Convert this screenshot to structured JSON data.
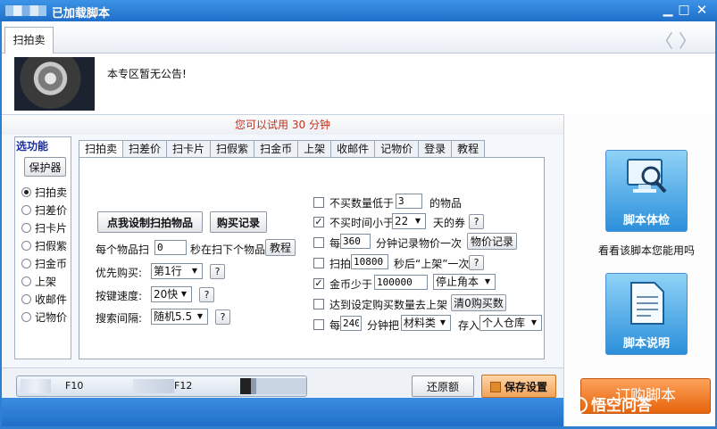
{
  "window": {
    "title": "已加载脚本",
    "minimize": "▁",
    "maximize": "□",
    "close": "✕"
  },
  "top_tab": {
    "label": "扫拍卖",
    "prev": "〈",
    "next": "〉"
  },
  "announcement": {
    "text": "本专区暂无公告!"
  },
  "trial": {
    "prefix": "您可以试用",
    "minutes": "30",
    "suffix": "分钟"
  },
  "functions": {
    "title": "选功能",
    "protector_label": "保护器",
    "items": [
      {
        "label": "扫拍卖",
        "selected": true
      },
      {
        "label": "扫差价",
        "selected": false
      },
      {
        "label": "扫卡片",
        "selected": false
      },
      {
        "label": "扫假紫",
        "selected": false
      },
      {
        "label": "扫金币",
        "selected": false
      },
      {
        "label": "上架",
        "selected": false
      },
      {
        "label": "收邮件",
        "selected": false
      },
      {
        "label": "记物价",
        "selected": false
      }
    ]
  },
  "tabs": [
    "扫拍卖",
    "扫差价",
    "扫卡片",
    "扫假紫",
    "扫金币",
    "上架",
    "收邮件",
    "记物价",
    "登录",
    "教程"
  ],
  "left_form": {
    "set_items_button": "点我设制扫拍物品",
    "purchase_record_button": "购买记录",
    "scan_prefix": "每个物品扫",
    "scan_value": "0",
    "scan_suffix": "秒在扫下个物品",
    "tutorial_button": "教程",
    "priority_label": "优先购买:",
    "priority_value": "第1行",
    "key_speed_label": "按键速度:",
    "key_speed_value": "20快",
    "interval_label": "搜索间隔:",
    "interval_value": "随机5.5",
    "help": "?"
  },
  "right_form": {
    "min_qty": {
      "checked": false,
      "prefix": "不买数量低于",
      "value": "3",
      "suffix": "的物品"
    },
    "time_limit": {
      "checked": true,
      "prefix": "不买时间小于",
      "value": "22",
      "suffix": "天的券"
    },
    "record_price": {
      "checked": false,
      "prefix": "每",
      "value": "360",
      "suffix": "分钟记录物价一次",
      "button": "物价记录"
    },
    "scan_listing": {
      "checked": false,
      "prefix": "扫拍",
      "value": "10800",
      "suffix": "秒后“上架”一次"
    },
    "gold_below": {
      "checked": true,
      "prefix": "金币少于",
      "value": "100000",
      "action": "停止角本"
    },
    "listing_after": {
      "checked": false,
      "label": "达到设定购买数量去上架",
      "button": "清0购买数"
    },
    "deposit": {
      "checked": false,
      "prefix": "每",
      "value": "240",
      "mid": "分钟把",
      "type_value": "材料类",
      "store_label": "存入",
      "store_value": "个人仓库"
    }
  },
  "right_panel": {
    "check_button": "脚本体检",
    "check_hint": "看看该脚本您能用吗",
    "manual_button": "脚本说明",
    "order_button": "订购脚本"
  },
  "bottom": {
    "hotkey1": "F10",
    "hotkey2": "F12",
    "restore_button": "还原额",
    "save_button": "保存设置"
  },
  "watermark": "悟空问答"
}
